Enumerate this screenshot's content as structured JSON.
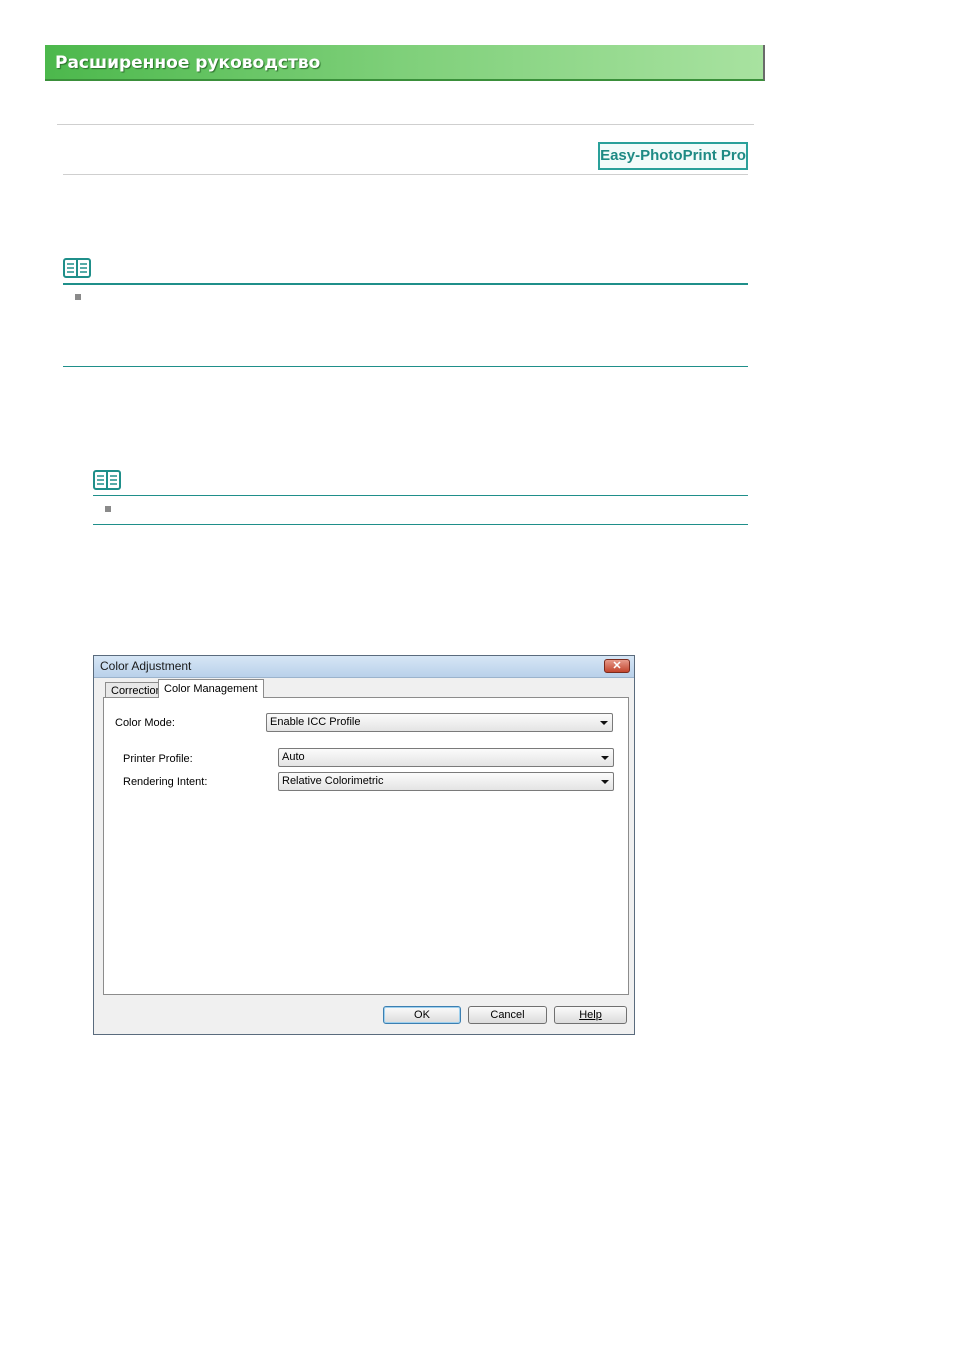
{
  "header": {
    "title": "Расширенное руководство"
  },
  "badge": {
    "text": "Easy-PhotoPrint Pro"
  },
  "icons": {
    "note": "note-book-icon",
    "bullet": "square-bullet"
  },
  "colors": {
    "header_green": "#4cb84c",
    "accent_teal": "#1f8f8a",
    "badge_teal": "#2aa09a"
  },
  "dialog": {
    "title": "Color Adjustment",
    "close_label": "✕",
    "tabs": [
      {
        "label": "Correction",
        "active": false
      },
      {
        "label": "Color Management",
        "active": true
      }
    ],
    "color_mode": {
      "label": "Color Mode:",
      "value": "Enable ICC Profile"
    },
    "printer_profile": {
      "label": "Printer Profile:",
      "value": "Auto"
    },
    "rendering_intent": {
      "label": "Rendering Intent:",
      "value": "Relative Colorimetric"
    },
    "buttons": {
      "ok": "OK",
      "cancel": "Cancel",
      "help": "Help"
    }
  }
}
